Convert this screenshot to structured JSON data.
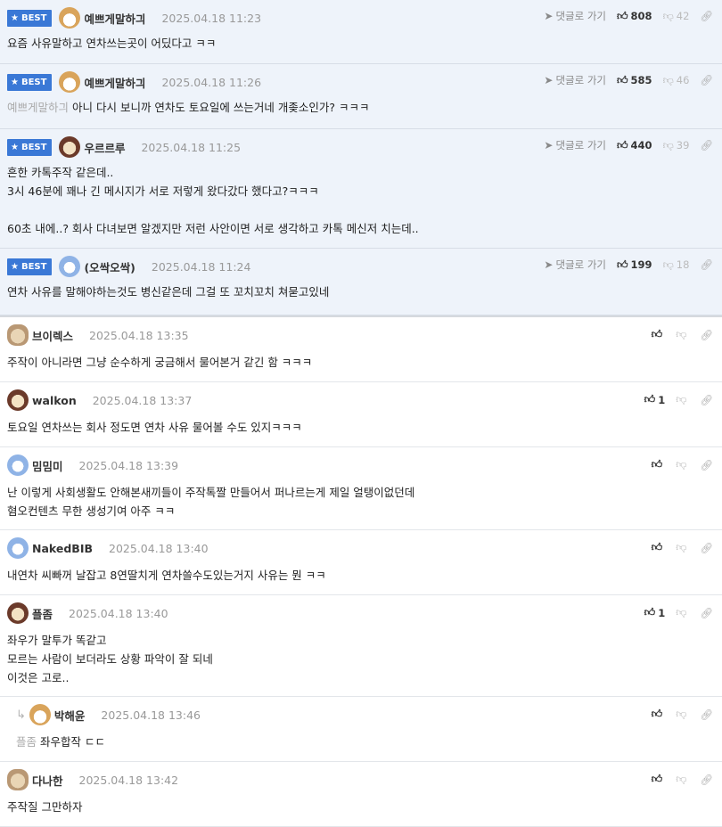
{
  "labels": {
    "best": "BEST",
    "go_reply": "댓글로 가기"
  },
  "best_comments": [
    {
      "nick": "예쁘게말하긔",
      "date": "2025.04.18 11:23",
      "avatar": "dog-avatar",
      "up": "808",
      "down": "42",
      "lines": [
        "요즘 사유말하고 연차쓰는곳이 어딨다고 ㅋㅋ"
      ]
    },
    {
      "nick": "예쁘게말하긔",
      "date": "2025.04.18 11:26",
      "avatar": "dog-avatar",
      "up": "585",
      "down": "46",
      "mention": "예쁘게말하긔",
      "lines": [
        "아니 다시 보니까 연차도 토요일에 쓰는거네 개좆소인가? ㅋㅋㅋ"
      ]
    },
    {
      "nick": "우르르루",
      "date": "2025.04.18 11:25",
      "avatar": "brown-avatar",
      "up": "440",
      "down": "39",
      "lines": [
        "흔한 카톡주작 같은데..",
        "3시 46분에 꽤나 긴 메시지가 서로 저렇게 왔다갔다 했다고?ㅋㅋㅋ",
        "",
        "60초 내에..? 회사 다녀보면 알겠지만 저런 사안이면 서로 생각하고 카톡 메신저 치는데.."
      ]
    },
    {
      "nick": "(오싹오싹)",
      "date": "2025.04.18 11:24",
      "avatar": "blue-avatar",
      "up": "199",
      "down": "18",
      "lines": [
        "연차 사유를 말해야하는것도 병신같은데 그걸 또 꼬치꼬치 쳐묻고있네"
      ]
    }
  ],
  "comments": [
    {
      "nick": "브이렉스",
      "date": "2025.04.18 13:35",
      "avatar": "tan-avatar",
      "up": "",
      "lines": [
        "주작이 아니라면 그냥 순수하게 궁금해서 물어본거 같긴 함 ㅋㅋㅋ"
      ]
    },
    {
      "nick": "walkon",
      "date": "2025.04.18 13:37",
      "avatar": "brown-avatar",
      "up": "1",
      "lines": [
        "토요일 연차쓰는 회사 정도면 연차 사유 물어볼 수도 있지ㅋㅋㅋ"
      ]
    },
    {
      "nick": "밈밈미",
      "date": "2025.04.18 13:39",
      "avatar": "blue-avatar",
      "up": "",
      "lines": [
        "난 이렇게 사회생활도 안해본새끼들이 주작톡짤 만들어서 퍼나르는게 제일 얼탱이없던데",
        "혐오컨텐츠 무한 생성기여 아주 ㅋㅋ"
      ]
    },
    {
      "nick": "NakedBIB",
      "date": "2025.04.18 13:40",
      "avatar": "blue-avatar",
      "up": "",
      "lines": [
        "내연차 씨빠꺼 날잡고 8연딸치게 연차쓸수도있는거지 사유는 뭔 ㅋㅋ"
      ]
    },
    {
      "nick": "플좀",
      "date": "2025.04.18 13:40",
      "avatar": "brown-avatar",
      "up": "1",
      "lines": [
        "좌우가 말투가 똑같고",
        "모르는 사람이 보더라도 상황 파악이 잘 되네",
        "이것은 고로.."
      ]
    },
    {
      "nick": "박해윤",
      "date": "2025.04.18 13:46",
      "avatar": "dog-avatar",
      "up": "",
      "reply": true,
      "mention": "플좀",
      "lines": [
        "좌우합작 ㄷㄷ"
      ]
    },
    {
      "nick": "다나한",
      "date": "2025.04.18 13:42",
      "avatar": "tan-avatar",
      "up": "",
      "lines": [
        "주작질 그만하자"
      ]
    }
  ]
}
